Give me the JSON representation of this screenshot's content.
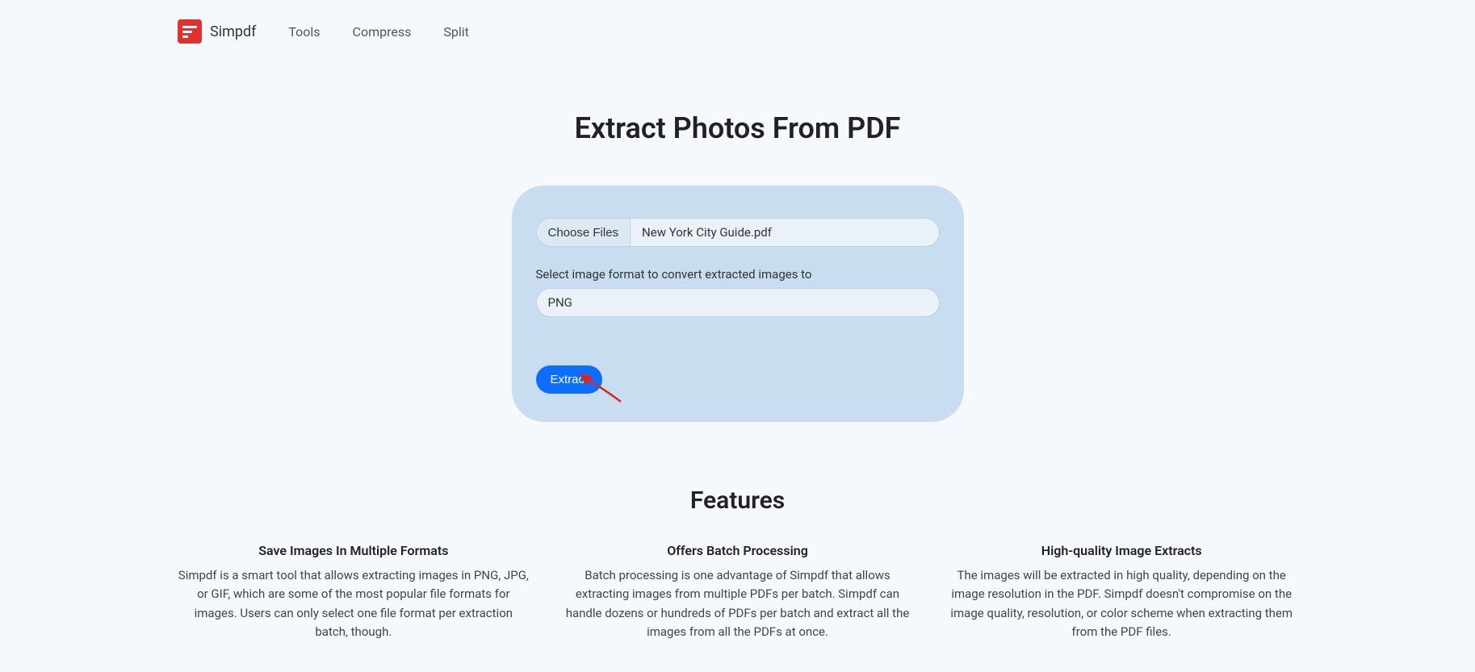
{
  "header": {
    "brand": "Simpdf",
    "nav": {
      "tools": "Tools",
      "compress": "Compress",
      "split": "Split"
    }
  },
  "page": {
    "title": "Extract Photos From PDF"
  },
  "upload": {
    "choose_files_label": "Choose Files",
    "selected_file": "New York City Guide.pdf",
    "format_label": "Select image format to convert extracted images to",
    "format_value": "PNG",
    "extract_label": "Extract"
  },
  "features": {
    "title": "Features",
    "cols": [
      {
        "heading": "Save Images In Multiple Formats",
        "text": "Simpdf is a smart tool that allows extracting images in PNG, JPG, or GIF, which are some of the most popular file formats for images. Users can only select one file format per extraction batch, though."
      },
      {
        "heading": "Offers Batch Processing",
        "text": "Batch processing is one advantage of Simpdf that allows extracting images from multiple PDFs per batch. Simpdf can handle dozens or hundreds of PDFs per batch and extract all the images from all the PDFs at once."
      },
      {
        "heading": "High-quality Image Extracts",
        "text": "The images will be extracted in high quality, depending on the image resolution in the PDF. Simpdf doesn't compromise on the image quality, resolution, or color scheme when extracting them from the PDF files."
      }
    ]
  }
}
